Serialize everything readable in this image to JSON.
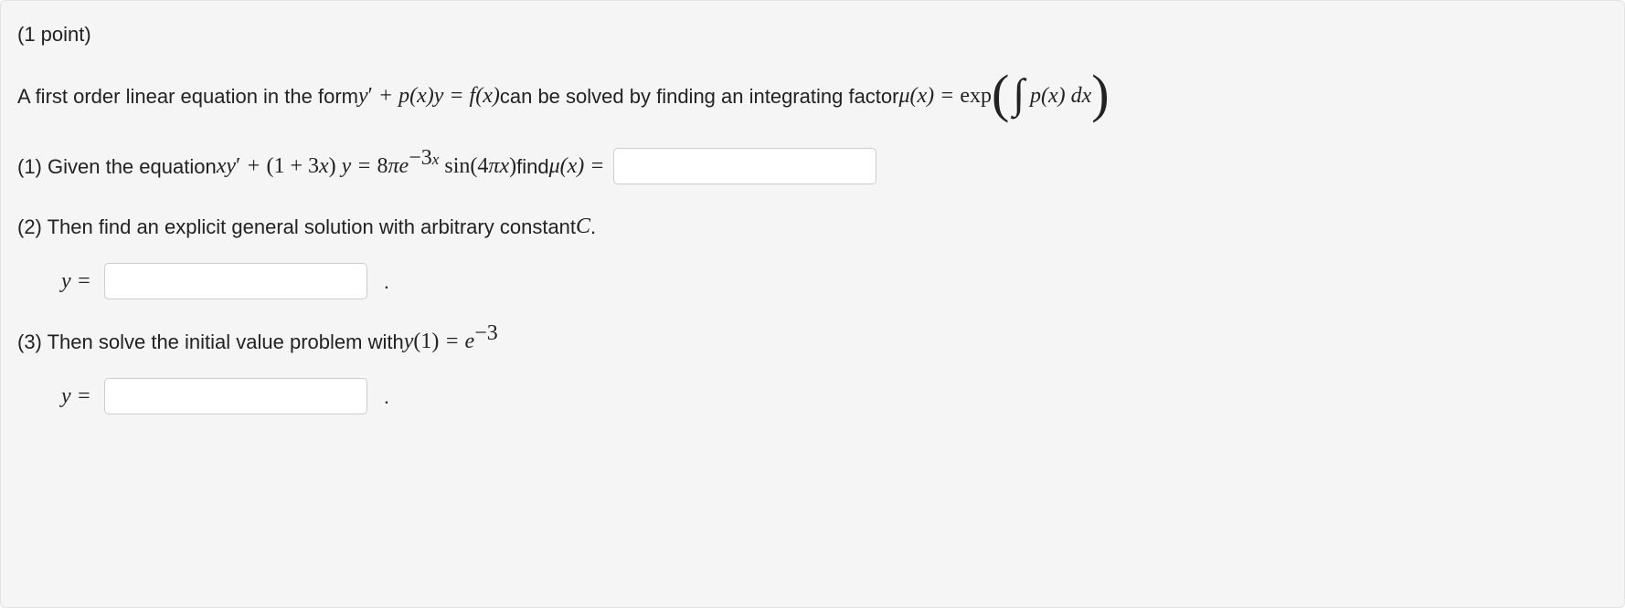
{
  "points_label": "(1 point)",
  "intro": {
    "pre": "A first order linear equation in the form ",
    "mid": " can be solved by finding an integrating factor "
  },
  "q1": {
    "pre": "(1) Given the equation ",
    "post": " find ",
    "mu_eq": "μ(x) ="
  },
  "q2": {
    "text": "(2) Then find an explicit general solution with arbitrary constant ",
    "const": "C",
    "dot": ".",
    "ylabel": "y ="
  },
  "q3": {
    "text": "(3) Then solve the initial value problem with ",
    "ylabel": "y ="
  },
  "period": "."
}
